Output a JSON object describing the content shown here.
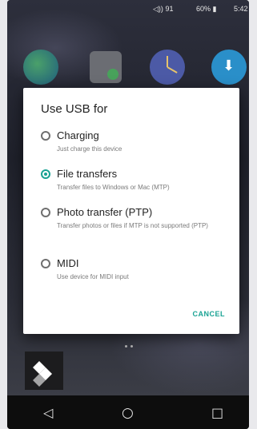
{
  "status_bar": {
    "volume_icon": "speaker-icon",
    "volume": "91",
    "battery": "60%",
    "time": "5:42"
  },
  "home_icons": [
    "globe-app-icon",
    "calculator-app-icon",
    "clock-app-icon",
    "download-app-icon"
  ],
  "dialog": {
    "title": "Use USB for",
    "options": [
      {
        "label": "Charging",
        "desc": "Just charge this device",
        "selected": false
      },
      {
        "label": "File transfers",
        "desc": "Transfer files to Windows or Mac (MTP)",
        "selected": true
      },
      {
        "label": "Photo transfer (PTP)",
        "desc": "Transfer photos or files if MTP is not supported (PTP)",
        "selected": false
      },
      {
        "label": "MIDI",
        "desc": "Use device for MIDI input",
        "selected": false
      }
    ],
    "cancel_label": "CANCEL",
    "accent_color": "#1aa394"
  },
  "nav_bar": {
    "back_icon": "◁",
    "home_icon": "○",
    "recents_icon": "□"
  }
}
